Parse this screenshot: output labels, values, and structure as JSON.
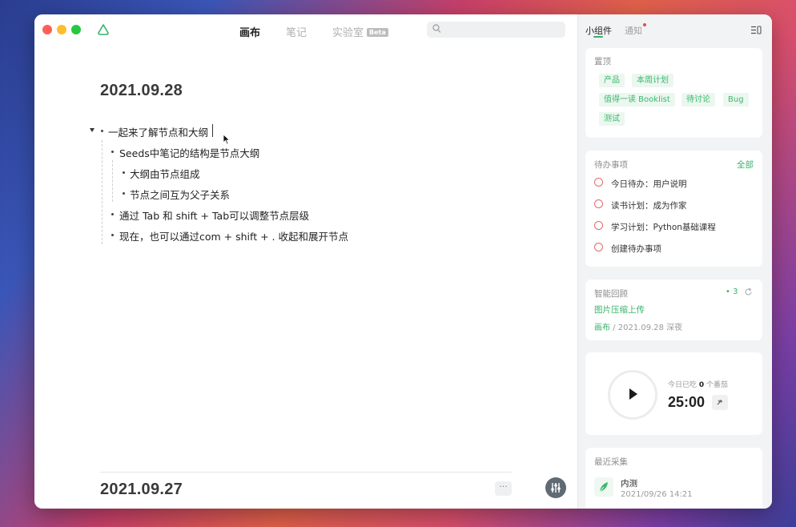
{
  "nav": {
    "tabs": [
      {
        "label": "画布",
        "active": true
      },
      {
        "label": "笔记",
        "active": false
      },
      {
        "label": "实验室",
        "badge": "Beta",
        "active": false
      }
    ],
    "search_placeholder": ""
  },
  "main": {
    "date_current": "2021.09.28",
    "outline": {
      "root": "一起来了解节点和大纲",
      "child1": "Seeds中笔记的结构是节点大纲",
      "child1_1": "大纲由节点组成",
      "child1_2": "节点之间互为父子关系",
      "child2": "通过 Tab 和 shift + Tab可以调整节点层级",
      "child3": "现在，也可以通过com + shift + . 收起和展开节点"
    },
    "date_next": "2021.09.27",
    "more_label": "···"
  },
  "sidebar": {
    "tabs": [
      {
        "label": "小组件",
        "active": true
      },
      {
        "label": "通知",
        "active": false,
        "has_unread": true
      }
    ],
    "pinned": {
      "title": "置顶",
      "tags": [
        "产品",
        "本周计划",
        "值得一读 Booklist",
        "待讨论",
        "Bug",
        "测试"
      ]
    },
    "todos": {
      "title": "待办事项",
      "all_label": "全部",
      "items": [
        "今日待办：用户说明",
        "读书计划：成为作家",
        "学习计划：Python基础课程",
        "创建待办事项"
      ]
    },
    "review": {
      "title": "智能回顾",
      "count": "• 3",
      "item_title": "图片压缩上传",
      "item_source": "画布",
      "item_meta": " / 2021.09.28 深夜"
    },
    "pomodoro": {
      "label_prefix": "今日已吃",
      "count": "0",
      "label_suffix": "个番茄",
      "time": "25:00"
    },
    "recent": {
      "title": "最近采集",
      "item_title": "内测",
      "item_time": "2021/09/26 14:21"
    }
  },
  "colors": {
    "accent_green": "#37b36a",
    "tag_bg": "#ebf7ef",
    "todo_circle": "#e26b6b",
    "notif_dot": "#e84b4b"
  },
  "icons": [
    "app-cloud-logo-icon",
    "search-icon",
    "play-icon",
    "shuffle-icon",
    "refresh-icon",
    "leaf-icon",
    "sidebar-menu-icon",
    "sliders-icon",
    "mouse-pointer-icon",
    "collapse-caret-icon"
  ]
}
